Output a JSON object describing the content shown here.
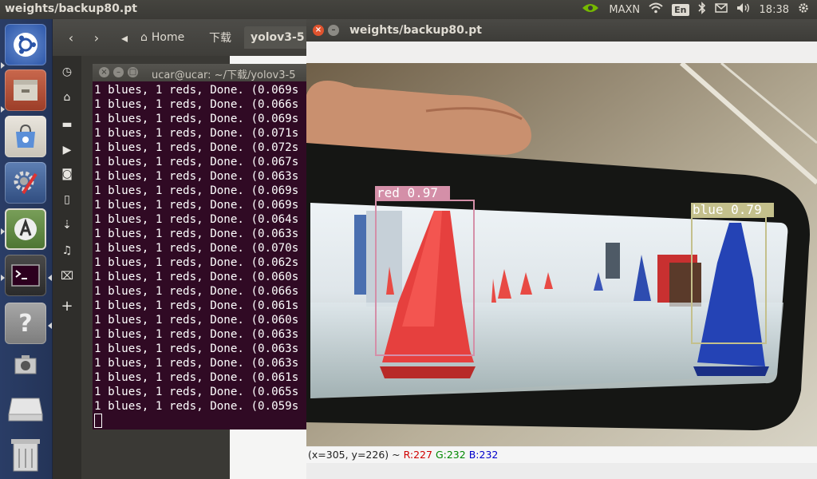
{
  "top_panel": {
    "window_title": "weights/backup80.pt",
    "nvidia": "MAXN",
    "keyboard": "En",
    "clock": "18:38"
  },
  "launcher": {
    "items": [
      "ubuntu-dash-icon",
      "files-icon",
      "software-center-icon",
      "settings-icon",
      "updater-icon",
      "terminal-icon",
      "help-icon",
      "screenshot-icon",
      "drive-icon",
      "trash-icon"
    ]
  },
  "file_manager": {
    "back": "‹",
    "forward": "›",
    "crumb_left": "◂",
    "crumb_home": "Home",
    "crumb_download": "下载",
    "crumb_folder": "yolov3-5"
  },
  "terminal": {
    "title": "ucar@ucar: ~/下载/yolov3-5",
    "lines": [
      "1 blues, 1 reds, Done. (0.069s",
      "1 blues, 1 reds, Done. (0.066s",
      "1 blues, 1 reds, Done. (0.069s",
      "1 blues, 1 reds, Done. (0.071s",
      "1 blues, 1 reds, Done. (0.072s",
      "1 blues, 1 reds, Done. (0.067s",
      "1 blues, 1 reds, Done. (0.063s",
      "1 blues, 1 reds, Done. (0.069s",
      "1 blues, 1 reds, Done. (0.069s",
      "1 blues, 1 reds, Done. (0.064s",
      "1 blues, 1 reds, Done. (0.063s",
      "1 blues, 1 reds, Done. (0.070s",
      "1 blues, 1 reds, Done. (0.062s",
      "1 blues, 1 reds, Done. (0.060s",
      "1 blues, 1 reds, Done. (0.066s",
      "1 blues, 1 reds, Done. (0.061s",
      "1 blues, 1 reds, Done. (0.060s",
      "1 blues, 1 reds, Done. (0.063s",
      "1 blues, 1 reds, Done. (0.063s",
      "1 blues, 1 reds, Done. (0.063s",
      "1 blues, 1 reds, Done. (0.061s",
      "1 blues, 1 reds, Done. (0.065s",
      "1 blues, 1 reds, Done. (0.059s"
    ]
  },
  "image_window": {
    "title": "weights/backup80.pt",
    "detections": [
      {
        "label": "red 0.97",
        "color": "#d48fa8"
      },
      {
        "label": "blue 0.79",
        "color": "#c4c08c"
      }
    ],
    "status": {
      "coords": "(x=305, y=226) ~",
      "r": "R:227",
      "g": "G:232",
      "b": "B:232"
    }
  },
  "colors": {
    "terminal_bg": "#300a24",
    "red_cone": "#e8403e",
    "blue_cone": "#2b4cc0"
  }
}
